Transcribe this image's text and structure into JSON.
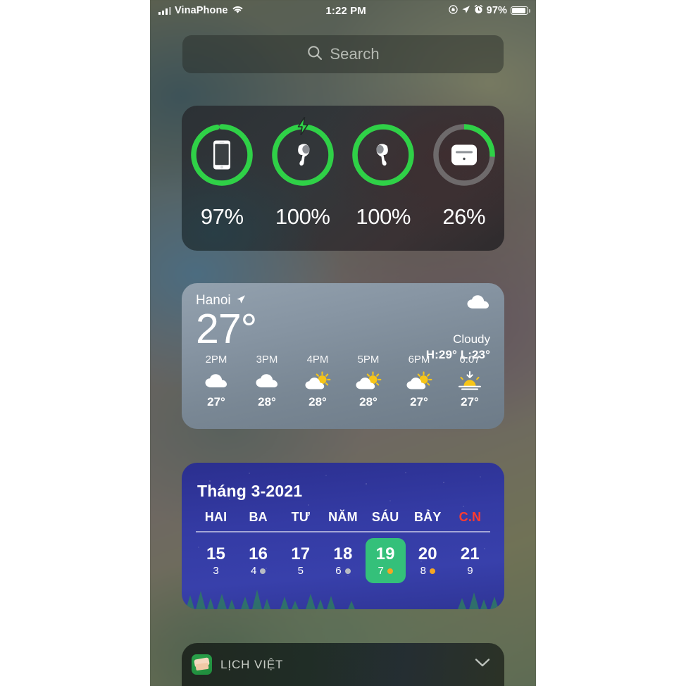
{
  "status_bar": {
    "carrier": "VinaPhone",
    "time": "1:22 PM",
    "battery_percent": "97%",
    "icons": [
      "signal-bars-icon",
      "wifi-icon",
      "rotation-lock-icon",
      "location-arrow-icon",
      "alarm-clock-icon",
      "battery-icon"
    ]
  },
  "search": {
    "placeholder": "Search",
    "icon": "search-icon"
  },
  "batteries_widget": {
    "items": [
      {
        "name": "iphone",
        "icon": "iphone-icon",
        "percent": "97%",
        "ring_value": 97,
        "charging": false,
        "ring_color": "#2fd147"
      },
      {
        "name": "airpod-left",
        "icon": "airpod-left-icon",
        "percent": "100%",
        "ring_value": 100,
        "charging": true,
        "ring_color": "#2fd147"
      },
      {
        "name": "airpod-right",
        "icon": "airpod-right-icon",
        "percent": "100%",
        "ring_value": 100,
        "charging": false,
        "ring_color": "#2fd147"
      },
      {
        "name": "airpods-case",
        "icon": "airpods-case-icon",
        "percent": "26%",
        "ring_value": 26,
        "charging": false,
        "ring_color": "#2fd147"
      }
    ]
  },
  "weather_widget": {
    "city": "Hanoi",
    "location_icon": "location-arrow-icon",
    "temperature": "27°",
    "condition": "Cloudy",
    "condition_icon": "cloud-icon",
    "high_low": "H:29° L:23°",
    "hours": [
      {
        "label": "2PM",
        "icon": "cloud-icon",
        "temp": "27°"
      },
      {
        "label": "3PM",
        "icon": "cloud-icon",
        "temp": "28°"
      },
      {
        "label": "4PM",
        "icon": "partly-sunny-icon",
        "temp": "28°"
      },
      {
        "label": "5PM",
        "icon": "partly-sunny-icon",
        "temp": "28°"
      },
      {
        "label": "6PM",
        "icon": "partly-sunny-icon",
        "temp": "27°"
      },
      {
        "label": "6:07",
        "icon": "sunset-icon",
        "temp": "27°"
      }
    ]
  },
  "calendar_widget": {
    "month_title": "Tháng 3-2021",
    "weekday_headers": [
      {
        "label": "HAI",
        "color": "#ffffff"
      },
      {
        "label": "BA",
        "color": "#ffffff"
      },
      {
        "label": "TƯ",
        "color": "#ffffff"
      },
      {
        "label": "NĂM",
        "color": "#ffffff"
      },
      {
        "label": "SÁU",
        "color": "#ffffff"
      },
      {
        "label": "BẢY",
        "color": "#ffffff"
      },
      {
        "label": "C.N",
        "color": "#ff3b30"
      }
    ],
    "days": [
      {
        "day": "15",
        "lunar": "3",
        "dot": null,
        "selected": false
      },
      {
        "day": "16",
        "lunar": "4",
        "dot": "#b8bcc4",
        "selected": false
      },
      {
        "day": "17",
        "lunar": "5",
        "dot": null,
        "selected": false
      },
      {
        "day": "18",
        "lunar": "6",
        "dot": "#b8bcc4",
        "selected": false
      },
      {
        "day": "19",
        "lunar": "7",
        "dot": "#f5a623",
        "selected": true
      },
      {
        "day": "20",
        "lunar": "8",
        "dot": "#f5a623",
        "selected": false
      },
      {
        "day": "21",
        "lunar": "9",
        "dot": null,
        "selected": false
      }
    ],
    "selected_color": "#34c07a"
  },
  "app_bar": {
    "app_name": "LỊCH VIỆT",
    "app_icon": "lich-viet-app-icon",
    "chevron_icon": "chevron-down-icon"
  }
}
